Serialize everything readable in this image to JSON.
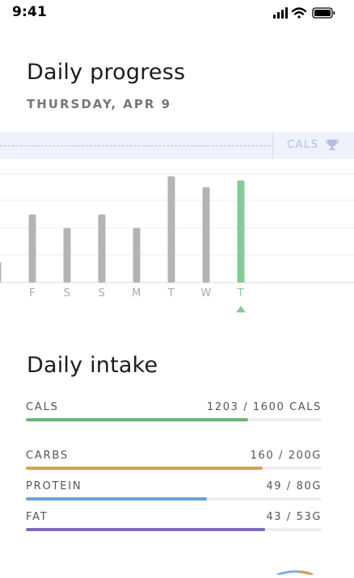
{
  "status_bar": {
    "time": "9:41",
    "icons": [
      "signal-icon",
      "wifi-icon",
      "battery-icon"
    ]
  },
  "progress": {
    "title": "Daily progress",
    "date": "THURSDAY, APR 9",
    "goal_label": "CALS",
    "goal_icon": "trophy-icon"
  },
  "chart_data": {
    "type": "bar",
    "categories": [
      "",
      "F",
      "S",
      "S",
      "M",
      "T",
      "W",
      "T"
    ],
    "values": [
      300,
      1000,
      800,
      1000,
      800,
      1560,
      1400,
      1500
    ],
    "ylim": [
      0,
      1600
    ],
    "highlight_index": 7,
    "colors": {
      "default": "#b4b4b4",
      "highlight": "#84cc96"
    },
    "grid": true,
    "selected_marker": "triangle-up"
  },
  "intake": {
    "title": "Daily intake",
    "nutrients": [
      {
        "name": "CALS",
        "value_label": "1203 / 1600 CALS",
        "progress": 0.752,
        "color": "#6fb37d"
      },
      {
        "name": "CARBS",
        "value_label": "160 / 200G",
        "progress": 0.8,
        "color": "#dba04f"
      },
      {
        "name": "PROTEIN",
        "value_label": "49 / 80G",
        "progress": 0.613,
        "color": "#6aa3d6"
      },
      {
        "name": "FAT",
        "value_label": "43 / 53G",
        "progress": 0.81,
        "color": "#7e6ab9"
      }
    ]
  }
}
